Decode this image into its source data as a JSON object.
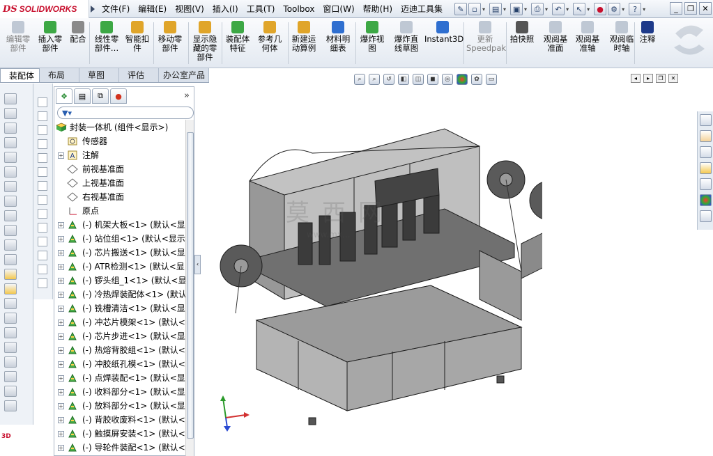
{
  "app": {
    "logo_ds": "DS",
    "logo_text": "SOLIDWORKS"
  },
  "menus": [
    "文件(F)",
    "编辑(E)",
    "视图(V)",
    "插入(I)",
    "工具(T)",
    "Toolbox",
    "窗口(W)",
    "帮助(H)",
    "迈迪工具集"
  ],
  "quick_access": {
    "help_label": "?"
  },
  "command_manager": [
    {
      "label": "编辑零\n部件",
      "disabled": true,
      "icon": "edit-component-icon"
    },
    {
      "label": "插入零\n部件",
      "disabled": false,
      "icon": "insert-component-icon"
    },
    {
      "label": "配合",
      "disabled": false,
      "icon": "mate-icon"
    },
    {
      "label": "线性零\n部件…",
      "disabled": false,
      "icon": "linear-pattern-icon"
    },
    {
      "label": "智能扣\n件",
      "disabled": false,
      "icon": "smart-fastener-icon"
    },
    {
      "label": "移动零\n部件",
      "disabled": false,
      "icon": "move-component-icon"
    },
    {
      "label": "显示隐\n藏的零\n部件",
      "disabled": false,
      "icon": "show-hidden-icon"
    },
    {
      "label": "装配体\n特征",
      "disabled": false,
      "icon": "assembly-feature-icon"
    },
    {
      "label": "参考几\n何体",
      "disabled": false,
      "icon": "reference-geometry-icon"
    },
    {
      "label": "新建运\n动算例",
      "disabled": false,
      "icon": "motion-study-icon"
    },
    {
      "label": "材料明\n细表",
      "disabled": false,
      "icon": "bom-icon"
    },
    {
      "label": "爆炸视\n图",
      "disabled": false,
      "icon": "exploded-view-icon"
    },
    {
      "label": "爆炸直\n线草图",
      "disabled": false,
      "icon": "explode-line-icon"
    },
    {
      "label": "Instant3D",
      "disabled": false,
      "icon": "instant3d-icon"
    },
    {
      "label": "更新\nSpeedpak",
      "disabled": true,
      "icon": "speedpak-icon"
    },
    {
      "label": "拍快照",
      "disabled": false,
      "icon": "snapshot-icon"
    },
    {
      "label": "观阅基\n准面",
      "disabled": false,
      "icon": "view-planes-icon"
    },
    {
      "label": "观阅基\n准轴",
      "disabled": false,
      "icon": "view-axes-icon"
    },
    {
      "label": "观阅临\n时轴",
      "disabled": false,
      "icon": "view-temp-axes-icon"
    },
    {
      "label": "注释",
      "disabled": false,
      "icon": "annotation-icon"
    }
  ],
  "tabs": [
    {
      "label": "装配体",
      "active": true
    },
    {
      "label": "布局",
      "active": false
    },
    {
      "label": "草图",
      "active": false
    },
    {
      "label": "评估",
      "active": false
    },
    {
      "label": "办公室产品",
      "active": false
    }
  ],
  "feature_manager": {
    "expand_arrows": "»",
    "root": "封装一体机 (组件<显示>)",
    "items": [
      {
        "label": "传感器",
        "icon": "sensor-icon",
        "expand": false
      },
      {
        "label": "注解",
        "icon": "annotation-folder-icon",
        "expand": true
      },
      {
        "label": "前视基准面",
        "icon": "plane-icon",
        "expand": false
      },
      {
        "label": "上视基准面",
        "icon": "plane-icon",
        "expand": false
      },
      {
        "label": "右视基准面",
        "icon": "plane-icon",
        "expand": false
      },
      {
        "label": "原点",
        "icon": "origin-icon",
        "expand": false
      },
      {
        "label": "(-) 机架大板<1> (默认<显",
        "icon": "subassembly-icon",
        "expand": true
      },
      {
        "label": "(-) 站位组<1> (默认<显示",
        "icon": "subassembly-icon",
        "expand": true
      },
      {
        "label": "(-) 芯片搬送<1> (默认<显",
        "icon": "subassembly-icon",
        "expand": true
      },
      {
        "label": "(-) ATR检测<1> (默认<显",
        "icon": "subassembly-icon",
        "expand": true
      },
      {
        "label": "(-) 锣头组_1<1> (默认<显",
        "icon": "subassembly-icon",
        "expand": true
      },
      {
        "label": "(-) 冷热焊装配体<1> (默认",
        "icon": "subassembly-icon",
        "expand": true
      },
      {
        "label": "(-) 铣槽清洁<1> (默认<显",
        "icon": "subassembly-icon",
        "expand": true
      },
      {
        "label": "(-) 冲芯片模架<1> (默认<",
        "icon": "subassembly-icon",
        "expand": true
      },
      {
        "label": "(-) 芯片步进<1> (默认<显",
        "icon": "subassembly-icon",
        "expand": true
      },
      {
        "label": "(-) 热熔背胶组<1> (默认<",
        "icon": "subassembly-icon",
        "expand": true
      },
      {
        "label": "(-) 冲胶纸孔模<1> (默认<",
        "icon": "subassembly-icon",
        "expand": true
      },
      {
        "label": "(-) 点焊装配<1> (默认<显",
        "icon": "subassembly-icon",
        "expand": true
      },
      {
        "label": "(-) 收料部分<1> (默认<显",
        "icon": "subassembly-icon",
        "expand": true
      },
      {
        "label": "(-) 放料部分<1> (默认<显",
        "icon": "subassembly-icon",
        "expand": true
      },
      {
        "label": "(-) 背胶收废料<1> (默认<",
        "icon": "subassembly-icon",
        "expand": true
      },
      {
        "label": "(-) 触摸屏安装<1> (默认<",
        "icon": "subassembly-icon",
        "expand": true
      },
      {
        "label": "(-) 导轮件装配<1> (默认<",
        "icon": "subassembly-icon",
        "expand": true
      }
    ]
  },
  "watermark": {
    "text": "莫西网",
    "url": "www.mx..."
  },
  "colors": {
    "accent": "#c8102e",
    "assembly_icon": "#2f8f3a",
    "link_blue": "#2a5fb0"
  }
}
